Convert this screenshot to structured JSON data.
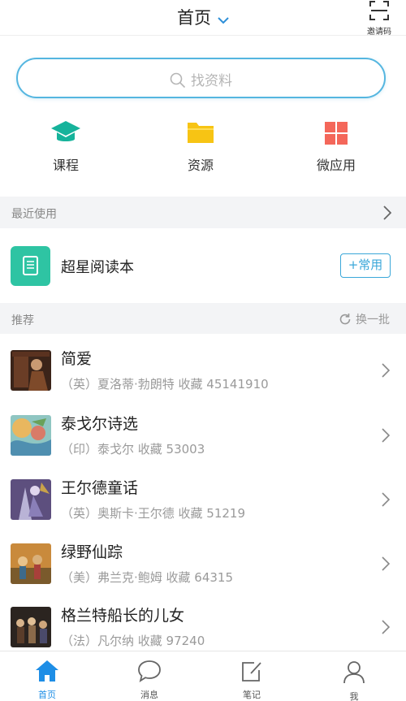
{
  "header": {
    "title": "首页",
    "invite_label": "邀请码"
  },
  "search": {
    "placeholder": "找资料"
  },
  "quick_links": [
    {
      "label": "课程",
      "icon": "graduation-cap-icon",
      "color": "#16b39b"
    },
    {
      "label": "资源",
      "icon": "folder-icon",
      "color": "#f7c414"
    },
    {
      "label": "微应用",
      "icon": "app-grid-icon",
      "color": "#f4675a"
    }
  ],
  "recent": {
    "title": "最近使用",
    "app": {
      "name": "超星阅读本",
      "icon": "reader-icon",
      "add_label": "+常用"
    }
  },
  "recommend": {
    "title": "推荐",
    "refresh_label": "换一批",
    "books": [
      {
        "title": "简爱",
        "meta": "（英）夏洛蒂·勃朗特 收藏 45141910"
      },
      {
        "title": "泰戈尔诗选",
        "meta": "（印）泰戈尔 收藏 53003"
      },
      {
        "title": "王尔德童话",
        "meta": "（英）奥斯卡·王尔德 收藏 51219"
      },
      {
        "title": "绿野仙踪",
        "meta": "（美）弗兰克·鲍姆 收藏 64315"
      },
      {
        "title": "格兰特船长的儿女",
        "meta": "（法）凡尔纳 收藏 97240"
      }
    ]
  },
  "tabbar": [
    {
      "label": "首页",
      "icon": "home-icon",
      "active": true
    },
    {
      "label": "消息",
      "icon": "chat-bubble-icon"
    },
    {
      "label": "笔记",
      "icon": "note-edit-icon"
    },
    {
      "label": "我",
      "icon": "person-icon"
    }
  ],
  "colors": {
    "accent": "#1e8ee6",
    "search_border": "#55b6e0",
    "section_bg": "#f3f4f6"
  }
}
